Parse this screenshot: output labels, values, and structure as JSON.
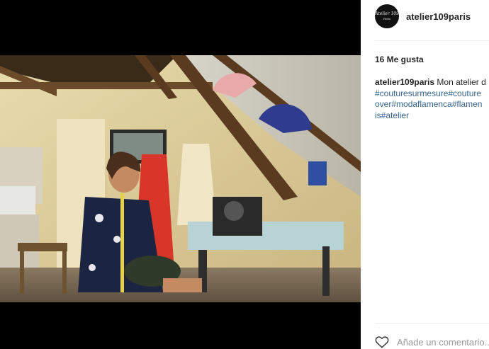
{
  "post": {
    "username": "atelier109paris",
    "avatar_text_line1": "Atelier 109",
    "avatar_text_line2": "Paris",
    "likes": "16 Me gusta",
    "caption": {
      "user": "atelier109paris",
      "line1_text": " Mon atelier d",
      "line2_tags": "#couturesurmesure#couture",
      "line3_tags": "over#modaflamenca#flamen",
      "line4_tags": "is#atelier"
    },
    "comment_placeholder": "Añade un comentario...",
    "photo_alt": "Woman sewing in attic atelier"
  },
  "icons": {
    "like": "heart-icon"
  },
  "colors": {
    "link": "#35638e",
    "text": "#262626",
    "muted": "#999999",
    "media_bg": "#000000"
  }
}
